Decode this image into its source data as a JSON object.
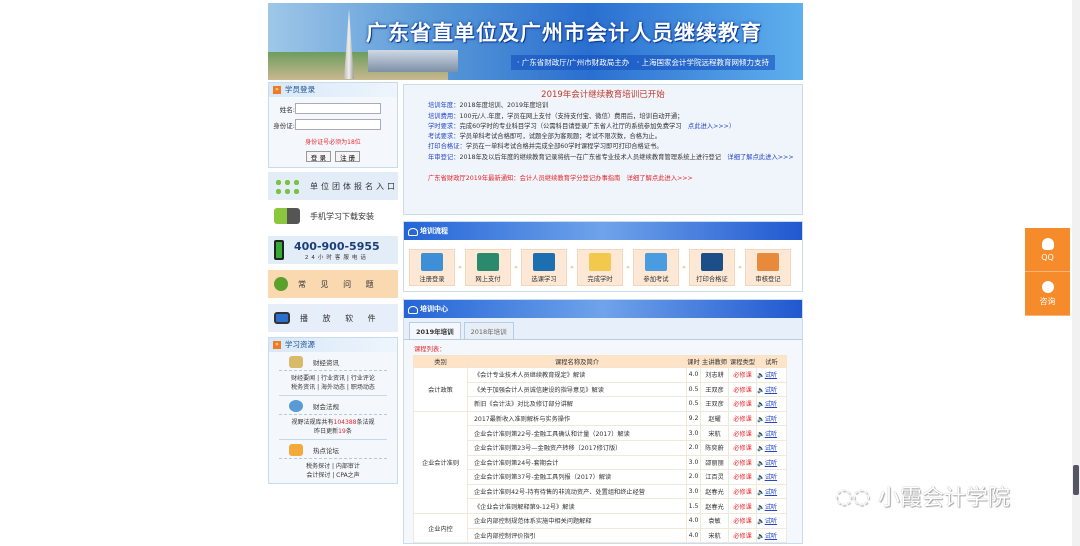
{
  "banner": {
    "title": "广东省直单位及广州市会计人员继续教育",
    "subtitle": "· 广东省财政厅/广州市财政局主办　· 上海国家会计学院远程教育网倾力支持"
  },
  "login": {
    "title": "学员登录",
    "name_label": "姓名:",
    "id_label": "身份证:",
    "warning": "身份证号必须为18位",
    "login_button": "登 录",
    "register_button": "注 册"
  },
  "panels": {
    "group": "单位团体报名入口",
    "mobile": "手机学习下载安装",
    "phone": "400-900-5955",
    "phone_sub": "24小时客服电话",
    "faq": "常 见 问 题",
    "player": "播 放 软 件"
  },
  "resources": {
    "title": "学习资源",
    "finance_news": {
      "title": "财经资讯",
      "links1": "财经要闻 | 行业资讯 | 行业评论",
      "links2": "税务资讯 | 海外动态 | 职场动态"
    },
    "laws": {
      "title": "财会法规",
      "text_pre": "视野法规库共有",
      "count": "104388",
      "text_post": "条法规",
      "today_pre": "昨日更新",
      "today": "19",
      "today_post": "条"
    },
    "forum": {
      "title": "热点论坛",
      "links1": "税务探讨 | 内部审计",
      "links2": "会计探讨 | CPA之声"
    }
  },
  "notice": {
    "title": "2019年会计继续教育培训已开始",
    "items": [
      {
        "key": "培训年度：",
        "text": "2018年度培训、2019年度培训",
        "link": ""
      },
      {
        "key": "培训费用：",
        "text": "100元/人.年度，学员在网上支付（支持支付宝、微信）费用后，培训自动开通；",
        "link": ""
      },
      {
        "key": "学时要求：",
        "text": "完成60学时的专业科目学习（公需科目请登录广东省人社厅的系统参加免费学习　",
        "link": "点此进入>>>）"
      },
      {
        "key": "考试要求：",
        "text": "学员单科考试合格即可，试题全部为客观题；考试不限次数，合格为止。",
        "link": ""
      },
      {
        "key": "打印合格证：",
        "text": "学员在一单科考试合格并完成全部60学时课程学习即可打印合格证书。",
        "link": ""
      },
      {
        "key": "年审登记：",
        "text": "2018年及以后年度的继续教育记录将统一在广东省专业技术人员继续教育管理系统上进行登记　",
        "link": "详细了解点此进入>>>"
      }
    ],
    "red": "广东省财政厅2019年最新通知：会计人员继续教育学分登记办事指南　详细了解点此进入>>>"
  },
  "flow": {
    "title": "培训流程",
    "steps": [
      "注册登录",
      "网上支付",
      "选课学习",
      "完成学时",
      "参加考试",
      "打印合格证",
      "审核登记"
    ],
    "arrow": "»"
  },
  "center": {
    "title": "培训中心",
    "tabs": [
      "2019年培训",
      "2018年培训"
    ],
    "list_caption": "课程列表：",
    "headers": [
      "类别",
      "课程名称及简介",
      "课时",
      "主讲教师",
      "课程类型",
      "试听"
    ],
    "groups": [
      {
        "category": "会计政策",
        "rows": [
          [
            "《会计专业技术人员继续教育规定》解读",
            "4.0",
            "刘志耕",
            "必修课",
            "试听"
          ],
          [
            "《关于加强会计人员诚信建设的指导意见》解读",
            "0.5",
            "王双彦",
            "必修课",
            "试听"
          ],
          [
            "新旧《会计法》对比及修订部分讲解",
            "0.5",
            "王双彦",
            "必修课",
            "试听"
          ]
        ]
      },
      {
        "category": "企业会计准则",
        "rows": [
          [
            "2017最新收入准则解析与实务操作",
            "9.2",
            "赵耀",
            "必修课",
            "试听"
          ],
          [
            "企业会计准则第22号-金融工具确认和计量（2017）解读",
            "3.0",
            "宋航",
            "必修课",
            "试听"
          ],
          [
            "企业会计准则第23号—金融资产转移（2017修订版）",
            "2.0",
            "陈奕蔚",
            "必修课",
            "试听"
          ],
          [
            "企业会计准则第24号-套期会计",
            "3.0",
            "邵丽丽",
            "必修课",
            "试听"
          ],
          [
            "企业会计准则第37号-金融工具列报（2017）解读",
            "2.0",
            "江百灵",
            "必修课",
            "试听"
          ],
          [
            "企业会计准则42号-持有待售的非流动资产、处置组和终止经营",
            "3.0",
            "赵春光",
            "必修课",
            "试听"
          ],
          [
            "《企业会计准则解释第9-12号》解读",
            "1.5",
            "赵春光",
            "必修课",
            "试听"
          ]
        ]
      },
      {
        "category": "企业内控",
        "rows": [
          [
            "企业内部控制规范体系实施中相关问题解释",
            "4.0",
            "袁敏",
            "必修课",
            "试听"
          ],
          [
            "企业内部控制评价指引",
            "4.0",
            "宋航",
            "必修课",
            "试听"
          ]
        ]
      }
    ]
  },
  "side": {
    "qq": "QQ",
    "consult": "咨询"
  },
  "watermark": "小霞会计学院",
  "colors": {
    "accent": "#f68b2b",
    "link": "#2447c6",
    "red": "#e8262b"
  }
}
